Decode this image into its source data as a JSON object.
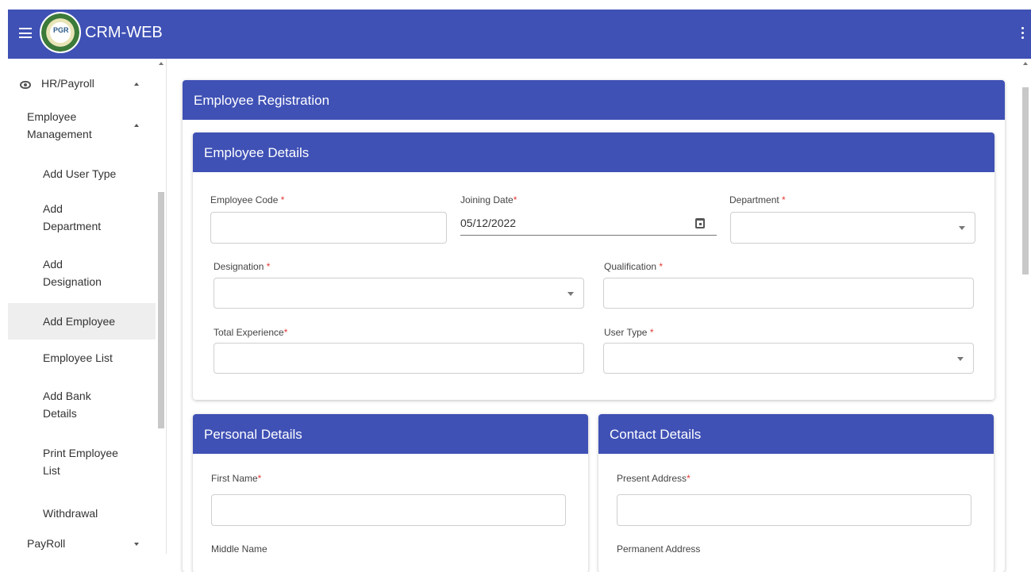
{
  "app": {
    "title": "CRM-WEB",
    "logo_text": "PGR"
  },
  "sidebar": {
    "section": "HR/Payroll",
    "group": "Employee Management",
    "items": [
      {
        "label": "Add User Type"
      },
      {
        "label": "Add Department"
      },
      {
        "label": "Add Designation"
      },
      {
        "label": "Add Employee",
        "active": true
      },
      {
        "label": "Employee List"
      },
      {
        "label": "Add Bank Details"
      },
      {
        "label": "Print Employee List"
      },
      {
        "label": "Withdrawal"
      }
    ],
    "payroll": "PayRoll"
  },
  "form": {
    "title": "Employee Registration",
    "employee_details": {
      "title": "Employee Details",
      "employee_code_label": "Employee Code",
      "joining_date_label": "Joining Date",
      "joining_date_value": "05/12/2022",
      "department_label": "Department",
      "designation_label": "Designation",
      "qualification_label": "Qualification",
      "total_experience_label": "Total Experience",
      "user_type_label": "User Type"
    },
    "personal_details": {
      "title": "Personal Details",
      "first_name_label": "First Name",
      "middle_name_label": "Middle Name"
    },
    "contact_details": {
      "title": "Contact Details",
      "present_address_label": "Present Address",
      "permanent_address_label": "Permanent Address"
    },
    "required_mark": "*"
  },
  "colors": {
    "primary": "#3f51b5",
    "required": "#e53935",
    "active_bg": "#eeeeee"
  }
}
